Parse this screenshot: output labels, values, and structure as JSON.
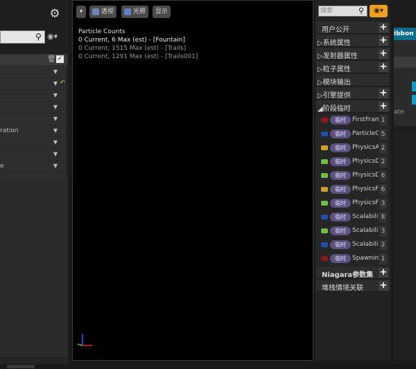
{
  "left": {
    "rows": [
      {
        "label": "",
        "reset": false
      },
      {
        "label": "",
        "reset": true
      },
      {
        "label": "",
        "reset": false
      },
      {
        "label": "",
        "reset": false
      },
      {
        "label": "",
        "reset": false
      },
      {
        "label": "ration",
        "reset": false
      },
      {
        "label": "",
        "reset": false
      },
      {
        "label": "",
        "reset": false
      },
      {
        "label": "e",
        "reset": false
      }
    ]
  },
  "viewport": {
    "buttons": {
      "perspective": "透视",
      "lit": "光照",
      "show": "显示"
    },
    "stats": {
      "title": "Particle Counts",
      "lines": [
        "0 Current, 6 Max (est) - [Fountain]",
        "0 Current, 1515 Max (est) - [Trails]",
        "0 Current, 1291 Max (est) - [Trails001]"
      ]
    }
  },
  "params": {
    "search_placeholder": "搜索",
    "categories_top": [
      "用户公开",
      "▷系统属性",
      "▷发射器属性",
      "▷粒子属性",
      "▷模块输出",
      "▷引擎提供",
      "◢阶段临时"
    ],
    "badge": "临时",
    "items": [
      {
        "name": "FirstFrame",
        "count": "1",
        "color": "#8a1a1a"
      },
      {
        "name": "ParticleC",
        "count": "5",
        "color": "#1f4fb0"
      },
      {
        "name": "PhysicsA",
        "count": "2",
        "color": "#d0a020"
      },
      {
        "name": "PhysicsD",
        "count": "2",
        "color": "#6fc040"
      },
      {
        "name": "PhysicsD",
        "count": "6",
        "color": "#6fc040"
      },
      {
        "name": "PhysicsF",
        "count": "6",
        "color": "#d0a020"
      },
      {
        "name": "PhysicsF",
        "count": "3",
        "color": "#6fc040"
      },
      {
        "name": "Scalabili",
        "count": "8",
        "color": "#1f4fb0"
      },
      {
        "name": "Scalabili",
        "count": "3",
        "color": "#6fc040"
      },
      {
        "name": "Scalabili",
        "count": "2",
        "color": "#1f4fb0"
      },
      {
        "name": "Spawnin",
        "count": "1",
        "color": "#8a1a1a"
      }
    ],
    "categories_bottom": [
      "Niagara参数集",
      "堆栈情境关联"
    ]
  },
  "graph": {
    "node_title": "ibbon",
    "node_sub": "ate"
  }
}
